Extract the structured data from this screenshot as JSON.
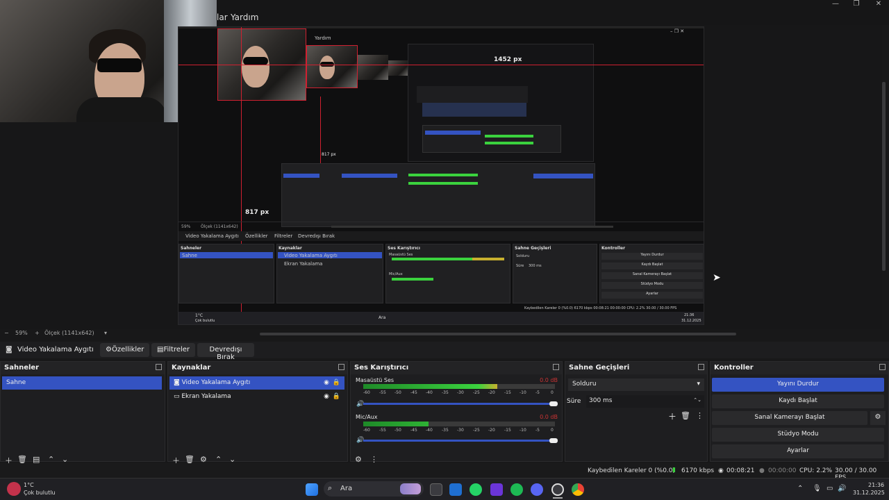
{
  "menu": {
    "partial": "lar",
    "help": "Yardım"
  },
  "preview": {
    "nested_help": "Yardım",
    "width_label": "1452 px",
    "height_label": "817 px",
    "inner_height_label": "817 px",
    "nested_sources_tab": "Video Yakalama Aygıtı",
    "nested_props": "Özellikler",
    "nested_filters": "Filtreler",
    "nested_deact": "Devredışı Bırak",
    "nested_scenes": "Sahneler",
    "nested_scene": "Sahne",
    "nested_sources": "Kaynaklar",
    "nested_src1": "Video Yakalama Aygıtı",
    "nested_src2": "Ekran Yakalama",
    "nested_mixer": "Ses Karıştırıcı",
    "nested_desktop": "Masaüstü Ses",
    "nested_mic": "Mic/Aux",
    "nested_trans": "Sahne Geçişleri",
    "nested_fade": "Solduru",
    "nested_dur_label": "Süre",
    "nested_dur": "300 ms",
    "nested_controls": "Kontroller",
    "nested_stop": "Yayını Durdur",
    "nested_rec": "Kaydı Başlat",
    "nested_vcam": "Sanal Kamerayı Başlat",
    "nested_studio": "Stüdyo Modu",
    "nested_settings": "Ayarlar",
    "nested_status": "Kaybedilen Kareler 0 (%0.0)   6170 kbps   00:08:21   00:00:00   CPU: 2.2%   30.00 / 30.00 FPS",
    "nested_search": "Ara",
    "nested_time": "21:36",
    "nested_date": "31.12.2025",
    "nested_weather": "1°C",
    "nested_weather2": "Çok bulutlu",
    "nested_zoom": "59%",
    "nested_scale": "Ölçek (1141x642)"
  },
  "zoom": {
    "percent": "59%",
    "scale": "Ölçek (1141x642)"
  },
  "filterbar": {
    "source_name": "Video Yakalama Aygıtı",
    "properties": "Özellikler",
    "filters": "Filtreler",
    "deactivate": "Devredışı Bırak"
  },
  "scenes": {
    "title": "Sahneler",
    "items": [
      "Sahne"
    ]
  },
  "sources": {
    "title": "Kaynaklar",
    "items": [
      "Video Yakalama Aygıtı",
      "Ekran Yakalama"
    ]
  },
  "mixer": {
    "title": "Ses Karıştırıcı",
    "channels": [
      {
        "name": "Masaüstü Ses",
        "db": "0.0 dB",
        "level": 0.7
      },
      {
        "name": "Mic/Aux",
        "db": "0.0 dB",
        "level": 0.34
      }
    ],
    "ticks": [
      "-60",
      "-55",
      "-50",
      "-45",
      "-40",
      "-35",
      "-30",
      "-25",
      "-20",
      "-15",
      "-10",
      "-5",
      "0"
    ]
  },
  "transitions": {
    "title": "Sahne Geçişleri",
    "selected": "Solduru",
    "duration_label": "Süre",
    "duration": "300 ms"
  },
  "controls": {
    "title": "Kontroller",
    "stop_stream": "Yayını Durdur",
    "start_recording": "Kaydı Başlat",
    "start_vcam": "Sanal Kamerayı Başlat",
    "studio_mode": "Stüdyo Modu",
    "settings": "Ayarlar"
  },
  "status": {
    "dropped": "Kaybedilen Kareler 0 (%0.0)",
    "bitrate": "6170 kbps",
    "stream_time": "00:08:21",
    "rec_time": "00:00:00",
    "cpu": "CPU: 2.2%",
    "fps": "30.00 / 30.00 FPS"
  },
  "taskbar": {
    "weather_temp": "1°C",
    "weather_desc": "Çok bulutlu",
    "search": "Ara",
    "time": "21:36",
    "date": "31.12.2025"
  },
  "colors": {
    "accent": "#3453c2",
    "guide": "#d02030",
    "meter_green": "#3bd23e"
  }
}
